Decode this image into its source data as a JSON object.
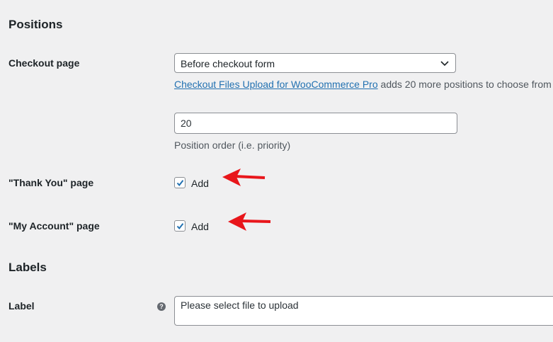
{
  "sections": {
    "positions_title": "Positions",
    "labels_title": "Labels"
  },
  "checkout": {
    "label": "Checkout page",
    "select_value": "Before checkout form",
    "pro_link": "Checkout Files Upload for WooCommerce Pro",
    "pro_text": " adds 20 more positions to choose from",
    "order_value": "20",
    "order_desc": "Position order (i.e. priority)"
  },
  "thank_you": {
    "label": "\"Thank You\" page",
    "checkbox_label": "Add",
    "checked": true
  },
  "my_account": {
    "label": "\"My Account\" page",
    "checkbox_label": "Add",
    "checked": true
  },
  "label_field": {
    "label": "Label",
    "value": "Please select file to upload"
  },
  "colors": {
    "arrow": "#e8161b",
    "link": "#2271b1",
    "checkmark": "#2271b1"
  }
}
